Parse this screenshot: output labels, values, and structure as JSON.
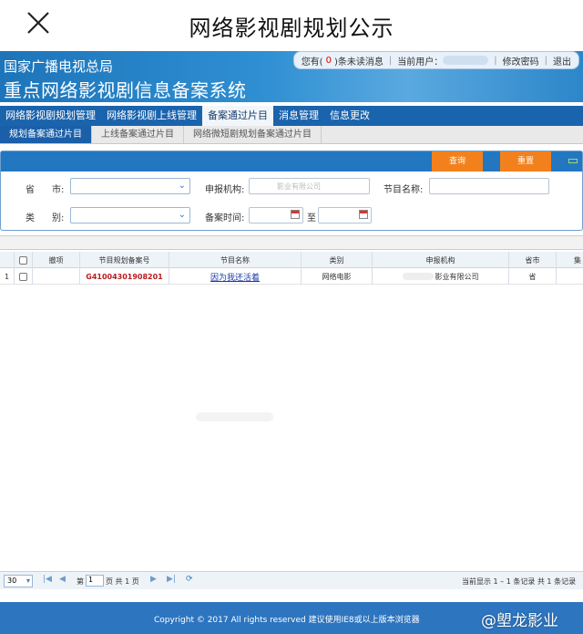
{
  "mobile_header": {
    "title": "网络影视剧规划公示"
  },
  "banner": {
    "line1": "国家广播电视总局",
    "line2": "重点网络影视剧信息备案系统",
    "user_bar": {
      "unread_prefix": "您有(",
      "unread_count": "0",
      "unread_suffix": ")条未读消息",
      "current_user_label": "当前用户：",
      "change_password": "修改密码",
      "logout": "退出"
    }
  },
  "main_nav": [
    {
      "label": "网络影视剧规划管理"
    },
    {
      "label": "网络影视剧上线管理"
    },
    {
      "label": "备案通过片目",
      "active": true
    },
    {
      "label": "消息管理"
    },
    {
      "label": "信息更改"
    }
  ],
  "sub_nav": [
    {
      "label": "规划备案通过片目",
      "active": true
    },
    {
      "label": "上线备案通过片目"
    },
    {
      "label": "网络微短剧规划备案通过片目"
    }
  ],
  "search": {
    "query_button": "查询",
    "reset_button": "重置",
    "province_label": "省",
    "city_label": "市:",
    "org_label": "申报机构:",
    "org_value": "影业有限公司",
    "program_label": "节目名称:",
    "type_label": "类",
    "type_label2": "别:",
    "date_label": "备案时间:",
    "date_to": "至"
  },
  "grid": {
    "headers": [
      "撤项",
      "节目规划备案号",
      "节目名称",
      "类别",
      "申报机构",
      "省市",
      "集"
    ],
    "rows": [
      {
        "index": "1",
        "code": "G41004301908201",
        "name": "因为我还活着",
        "category": "网络电影",
        "org": "影业有限公司",
        "province": "省"
      }
    ]
  },
  "pager": {
    "page_size": "30",
    "page_prefix": "第",
    "page_value": "1",
    "page_suffix": "页 共 1 页",
    "summary": "当前显示 1 – 1 条记录 共 1 条记录"
  },
  "footer": {
    "copyright": "Copyright © 2017 All rights reserved 建议使用IE8或以上版本浏览器"
  },
  "watermark": "@塱龙影业",
  "colors": {
    "nav_blue": "#1a63ad",
    "action_orange": "#f2811d",
    "code_red": "#b81c1c"
  }
}
